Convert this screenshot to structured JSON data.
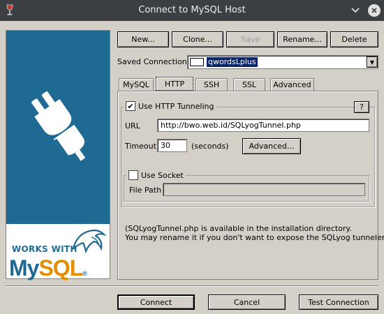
{
  "window": {
    "title": "Connect to MySQL Host"
  },
  "toolbar": {
    "new_label": "New...",
    "clone_label": "Clone...",
    "save_label": "Save",
    "rename_label": "Rename...",
    "delete_label": "Delete"
  },
  "saved_connections": {
    "label": "Saved Connections",
    "selected": "qwordsLplus"
  },
  "tabs": [
    {
      "label": "MySQL"
    },
    {
      "label": "HTTP"
    },
    {
      "label": "SSH"
    },
    {
      "label": "SSL"
    },
    {
      "label": "Advanced"
    }
  ],
  "http": {
    "use_tunneling_label": "Use HTTP Tunneling",
    "use_tunneling_checked": true,
    "help_label": "?",
    "url_label": "URL",
    "url_value": "http://bwo.web.id/SQLyogTunnel.php",
    "timeout_label": "Timeout",
    "timeout_value": "30",
    "timeout_unit": "(seconds)",
    "advanced_label": "Advanced...",
    "use_socket_label": "Use Socket",
    "use_socket_checked": false,
    "file_path_label": "File Path",
    "file_path_value": "",
    "note_line1": "(SQLyogTunnel.php is available in the installation directory.",
    "note_line2": "You may rename it if you don't want to expose the SQLyog tunneler)"
  },
  "branding": {
    "works_with": "WORKS WITH",
    "my": "My",
    "sql": "SQL",
    "reg": "®"
  },
  "footer": {
    "connect_label": "Connect",
    "cancel_label": "Cancel",
    "test_label": "Test Connection"
  },
  "colors": {
    "brand_blue": "#1f6a92",
    "mysql_orange": "#e48e00",
    "selection": "#0a246a",
    "titlebar": "#3c3f41"
  }
}
